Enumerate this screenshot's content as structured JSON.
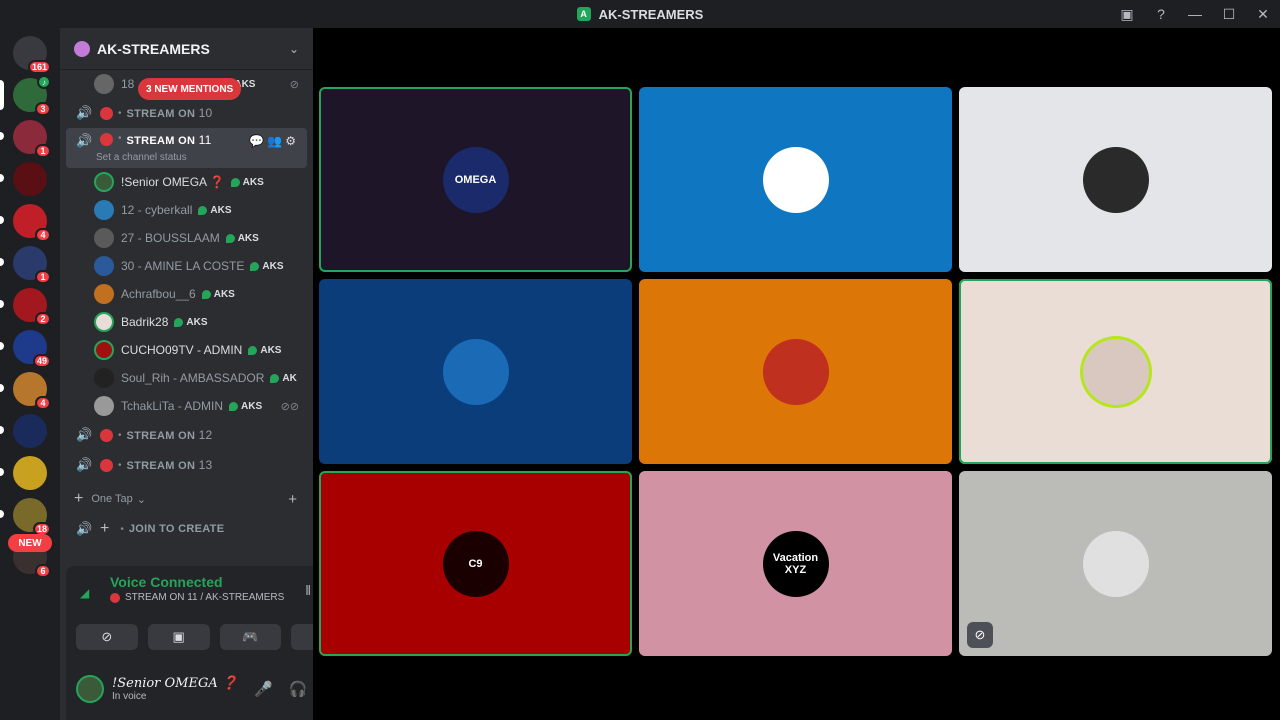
{
  "window": {
    "title": "AK-STREAMERS",
    "logo_letter": "A",
    "controls": [
      "inbox-icon",
      "help-icon",
      "minimize-icon",
      "maximize-icon",
      "close-icon"
    ]
  },
  "rail": {
    "home_badge": "161",
    "servers": [
      {
        "name": "server-1",
        "badge": "3",
        "color": "#2f6b3a",
        "speaking": true
      },
      {
        "name": "server-2",
        "badge": "1",
        "color": "#8a2a3a",
        "speaking": false
      },
      {
        "name": "server-3",
        "badge": "",
        "color": "#5a0f14",
        "speaking": false
      },
      {
        "name": "server-4",
        "badge": "4",
        "color": "#c01f28",
        "speaking": false
      },
      {
        "name": "server-5",
        "badge": "1",
        "color": "#2a3a6a",
        "speaking": false
      },
      {
        "name": "server-6",
        "badge": "2",
        "color": "#a3181e",
        "speaking": false
      },
      {
        "name": "server-7",
        "badge": "49",
        "color": "#1e3a8a",
        "speaking": false
      },
      {
        "name": "server-8",
        "badge": "4",
        "color": "#b6762c",
        "speaking": false
      },
      {
        "name": "server-9",
        "badge": "",
        "color": "#1a2a5a",
        "speaking": false
      },
      {
        "name": "server-10",
        "badge": "",
        "color": "#c9a120",
        "speaking": false
      },
      {
        "name": "server-11",
        "badge": "18",
        "color": "#7a6a2a",
        "speaking": false
      }
    ],
    "new_label": "NEW",
    "last_badge": "6"
  },
  "sidebar": {
    "server_name": "AK-STREAMERS",
    "mention_pill": "3 NEW MENTIONS",
    "top_user": {
      "name": "18",
      "tag": "AKS"
    },
    "channels_top": [
      {
        "label": "STREAM ON",
        "num": "10"
      }
    ],
    "active_channel": {
      "label": "STREAM ON",
      "num": "11",
      "status": "Set a channel status"
    },
    "members": [
      {
        "name": "!Senior OMEGA ❓",
        "tag": "AKS",
        "bright": true,
        "speaking": true,
        "color": "#3a5a3a"
      },
      {
        "name": "12 - cyberkall",
        "tag": "AKS",
        "bright": false,
        "speaking": false,
        "color": "#2a7ab5"
      },
      {
        "name": "27 - BOUSSLAAM",
        "tag": "AKS",
        "bright": false,
        "speaking": false,
        "color": "#5a5a5a"
      },
      {
        "name": "30 - AMINE LA COSTE",
        "tag": "AKS",
        "bright": false,
        "speaking": false,
        "color": "#2a5a9a"
      },
      {
        "name": "Achrafbou__6",
        "tag": "AKS",
        "bright": false,
        "speaking": false,
        "color": "#c0701f"
      },
      {
        "name": "Badrik28",
        "tag": "AKS",
        "bright": true,
        "speaking": true,
        "color": "#e8ddd8"
      },
      {
        "name": "CUCHO09TV - ADMIN",
        "tag": "AKS",
        "bright": true,
        "speaking": true,
        "color": "#a01010"
      },
      {
        "name": "Soul_Rih - AMBASSADOR",
        "tag": "AK",
        "bright": false,
        "speaking": false,
        "color": "#222"
      },
      {
        "name": "TchakLiTa - ADMIN",
        "tag": "AKS",
        "bright": false,
        "speaking": false,
        "color": "#999"
      }
    ],
    "channels_bottom": [
      {
        "label": "STREAM ON",
        "num": "12"
      },
      {
        "label": "STREAM ON",
        "num": "13"
      }
    ],
    "category": "One Tap",
    "join_label": "JOIN TO CREATE"
  },
  "voice": {
    "connected_label": "Voice Connected",
    "channel_path": "STREAM ON 11 / AK-STREAMERS",
    "buttons": [
      "camera-off-icon",
      "screen-share-icon",
      "activity-icon",
      "soundboard-icon"
    ]
  },
  "user": {
    "name": "!Senior OMEGA ❓",
    "status": "In voice"
  },
  "tiles": [
    {
      "name": "tile-senior-omega",
      "bg": "#1e1528",
      "speaking": true,
      "avatar_color": "#1a2a6a",
      "avatar_text": "OMEGA",
      "muted": false
    },
    {
      "name": "tile-cyberkall",
      "bg": "#0f77c2",
      "speaking": false,
      "avatar_color": "#ffffff",
      "avatar_text": "",
      "muted": false
    },
    {
      "name": "tile-bousslaam",
      "bg": "#e3e5e8",
      "speaking": false,
      "avatar_color": "#2a2a2a",
      "avatar_text": "",
      "muted": false
    },
    {
      "name": "tile-amine-la-coste",
      "bg": "#0b3d7a",
      "speaking": false,
      "avatar_color": "#1a6ab5",
      "avatar_text": "",
      "muted": false
    },
    {
      "name": "tile-achrafbou",
      "bg": "#dc7707",
      "speaking": false,
      "avatar_color": "#c0301f",
      "avatar_text": "",
      "muted": false
    },
    {
      "name": "tile-badrik28",
      "bg": "#eaddd6",
      "speaking": true,
      "avatar_color": "#d8c8c0",
      "avatar_text": "",
      "muted": false
    },
    {
      "name": "tile-cucho09tv",
      "bg": "#a80000",
      "speaking": true,
      "avatar_color": "#1a0000",
      "avatar_text": "C9",
      "muted": false
    },
    {
      "name": "tile-soul-rih",
      "bg": "#d193a4",
      "speaking": false,
      "avatar_color": "#000000",
      "avatar_text": "Vacation XYZ",
      "muted": false
    },
    {
      "name": "tile-tchaklita",
      "bg": "#bbbbb8",
      "speaking": false,
      "avatar_color": "#e0e0e0",
      "avatar_text": "",
      "muted": true
    }
  ]
}
